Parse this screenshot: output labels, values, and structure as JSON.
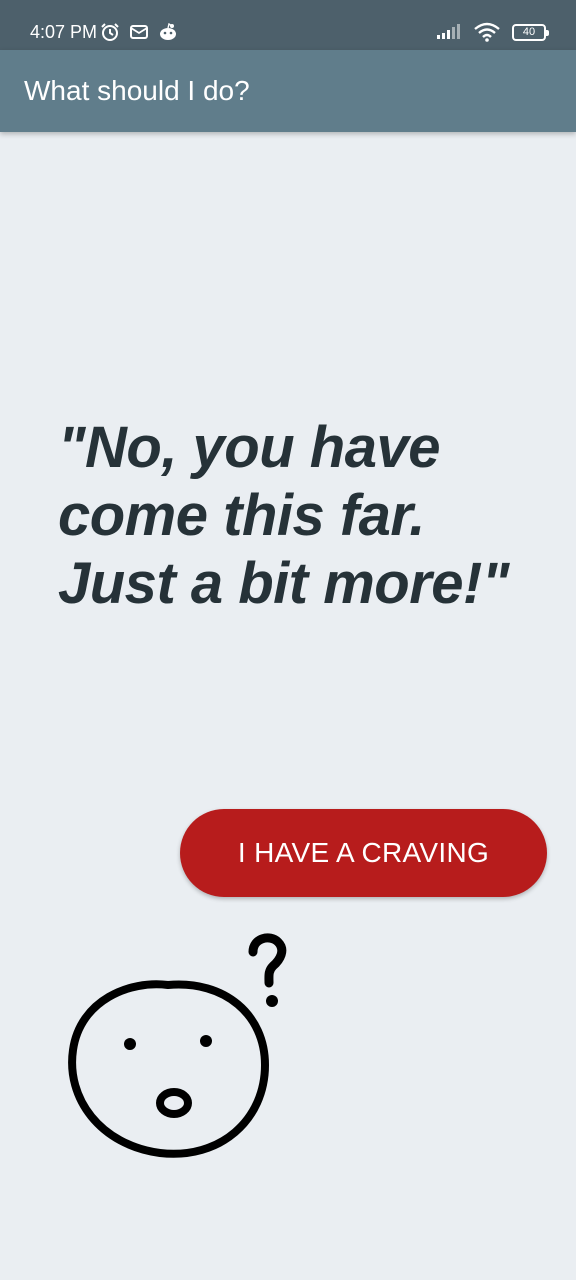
{
  "status_bar": {
    "time": "4:07 PM",
    "battery": "40",
    "icons_left": [
      "alarm-icon",
      "mail-icon",
      "reddit-icon"
    ],
    "icons_right": [
      "signal-icon",
      "wifi-icon",
      "battery-icon"
    ]
  },
  "app_bar": {
    "title": "What should I do?"
  },
  "main": {
    "quote": "\"No, you have come this far. Just a bit more!\"",
    "craving_button_label": "I HAVE A CRAVING"
  },
  "illustration": {
    "name": "confused-face-icon"
  },
  "colors": {
    "status_bar": "#4d606b",
    "app_bar": "#607d8b",
    "background": "#eaeef2",
    "quote_text": "#263238",
    "button": "#b71c1c"
  }
}
